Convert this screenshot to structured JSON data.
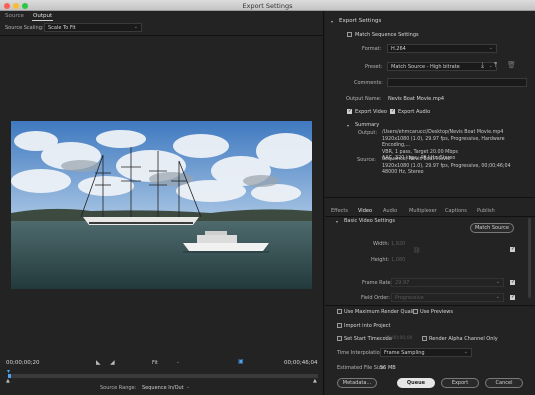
{
  "window": {
    "title": "Export Settings"
  },
  "source_tabs": [
    "Source",
    "Output"
  ],
  "output": {
    "source_scaling_label": "Source Scaling:",
    "source_scaling_value": "Scale To Fit"
  },
  "playback": {
    "current_time": "00;00;00;20",
    "fit_label": "Fit",
    "duration": "00;00;46;04",
    "source_range_label": "Source Range:",
    "source_range_value": "Sequence In/Out",
    "progress": 0.01
  },
  "export_settings": {
    "header": "Export Settings",
    "match_sequence_label": "Match Sequence Settings",
    "format_label": "Format:",
    "format_value": "H.264",
    "preset_label": "Preset:",
    "preset_value": "Match Source - High bitrate",
    "comments_label": "Comments:",
    "output_name_label": "Output Name:",
    "output_name_value": "Nevis Boat Movie.mp4",
    "export_video_label": "Export Video",
    "export_audio_label": "Export Audio"
  },
  "summary": {
    "header": "Summary",
    "output_label": "Output:",
    "output_lines": [
      "/Users/ehmcarucci/Desktop/Nevis Boat Movie.mp4",
      "1920x1080 (1.0), 29.97 fps, Progressive, Hardware Encoding,...",
      "VBR, 1 pass, Target 20.00 Mbps",
      "AAC, 320 kbps, 48 kHz, Stereo"
    ],
    "source_label": "Source:",
    "source_lines": [
      "Sequence, Nevis Boat Movie",
      "1920x1080 (1.0), 29.97 fps, Progressive, 00;00;46;04",
      "48000 Hz, Stereo"
    ]
  },
  "settings_tabs": [
    "Effects",
    "Video",
    "Audio",
    "Multiplexer",
    "Captions",
    "Publish"
  ],
  "basic_video": {
    "header": "Basic Video Settings",
    "match_source_button": "Match Source",
    "width_label": "Width:",
    "width_value": "1,920",
    "height_label": "Height:",
    "height_value": "1,080",
    "frame_rate_label": "Frame Rate:",
    "frame_rate_value": "29.97",
    "field_order_label": "Field Order:",
    "field_order_value": "Progressive"
  },
  "options": {
    "max_render_quality": "Use Maximum Render Quality",
    "use_previews": "Use Previews",
    "import_into_project": "Import into Project",
    "set_start_timecode": "Set Start Timecode",
    "start_timecode_value": "00;00;00;00",
    "render_alpha": "Render Alpha Channel Only",
    "time_interpolation_label": "Time Interpolation:",
    "time_interpolation_value": "Frame Sampling",
    "file_size_label": "Estimated File Size:",
    "file_size_value": "56 MB"
  },
  "buttons": {
    "metadata": "Metadata...",
    "queue": "Queue",
    "export": "Export",
    "cancel": "Cancel"
  },
  "colors": {
    "accent_blue": "#4da3f0",
    "panel_bg": "#232323"
  }
}
